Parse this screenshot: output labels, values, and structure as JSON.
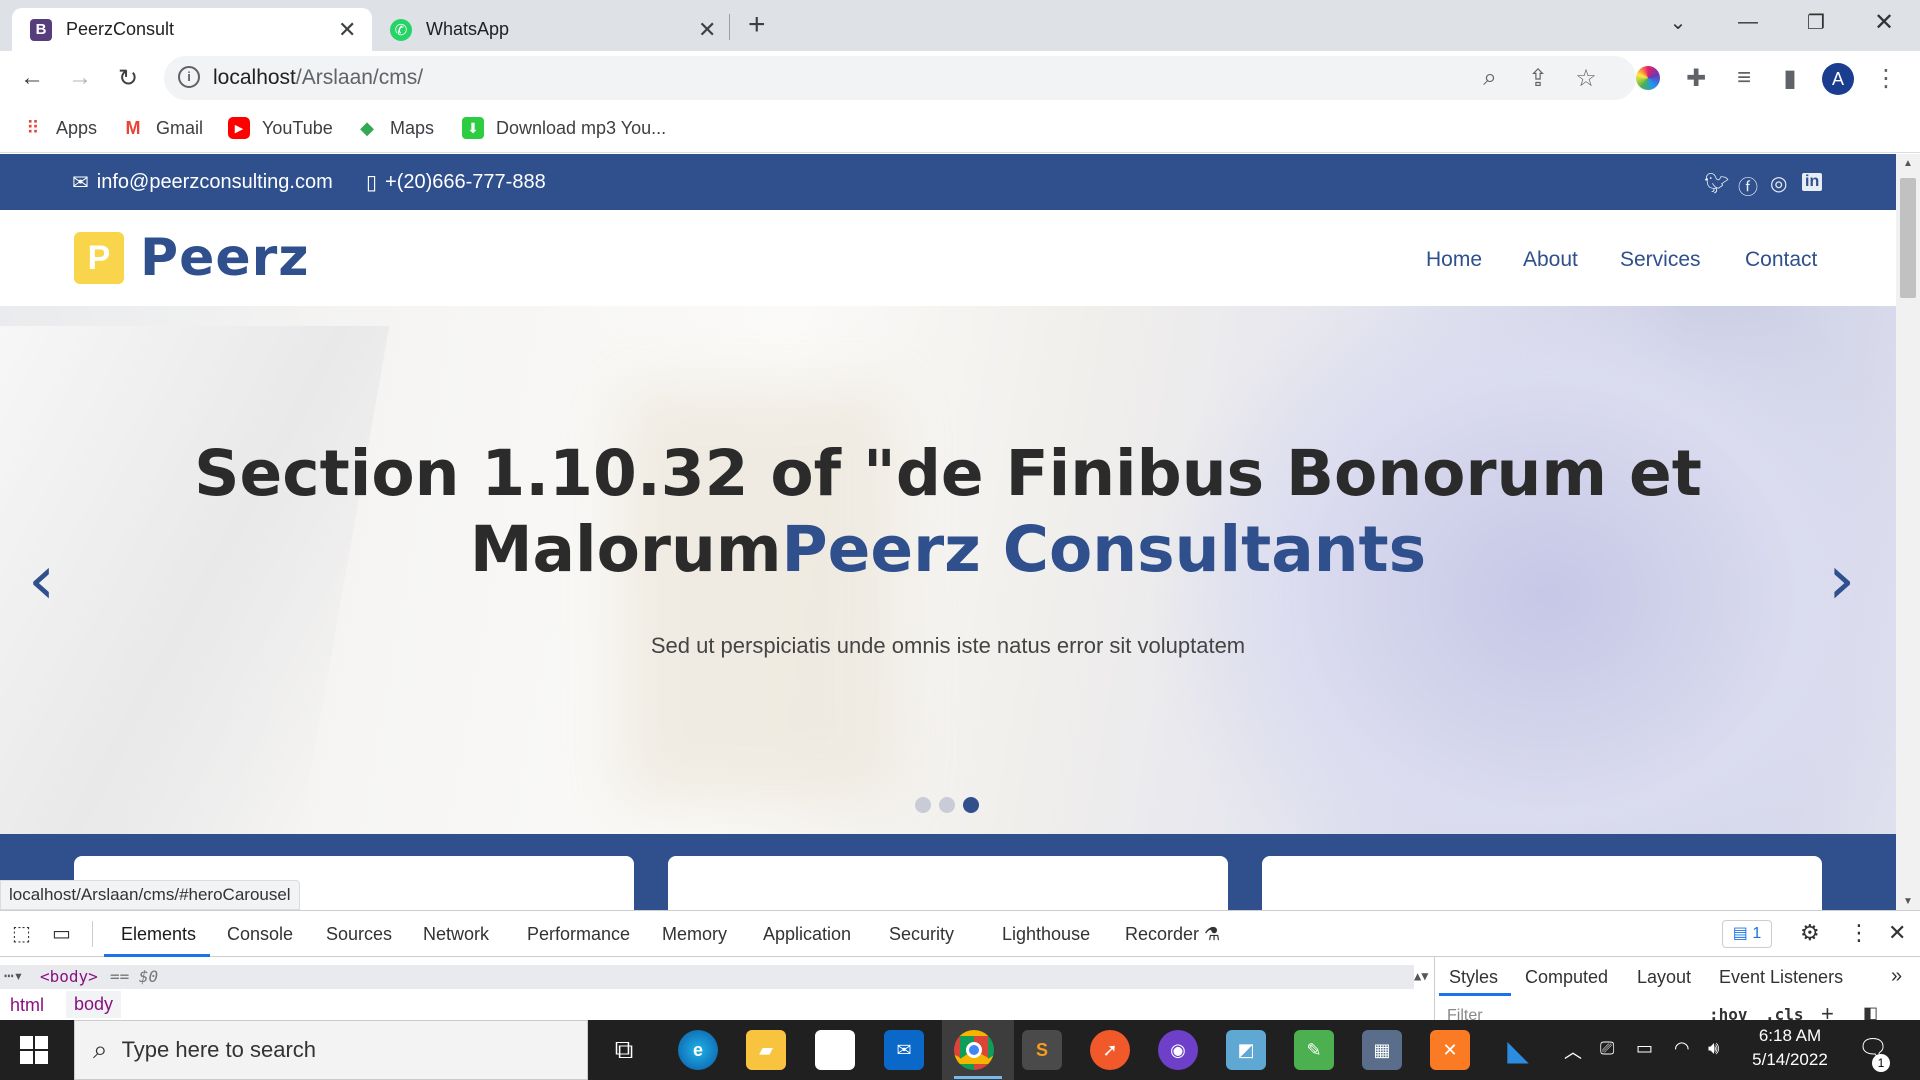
{
  "browser": {
    "tabs": [
      {
        "title": "PeerzConsult",
        "favicon_letter": "B",
        "favicon_color": "#563d7c"
      },
      {
        "title": "WhatsApp",
        "favicon_color": "#25d366"
      }
    ],
    "url_host": "localhost",
    "url_path": "/Arslaan/cms/",
    "bookmarks": [
      {
        "label": "Apps"
      },
      {
        "label": "Gmail"
      },
      {
        "label": "YouTube"
      },
      {
        "label": "Maps"
      },
      {
        "label": "Download mp3 You..."
      }
    ],
    "profile_letter": "A"
  },
  "site": {
    "email": "info@peerzconsulting.com",
    "phone": "+(20)666-777-888",
    "logo_letter": "P",
    "logo_text": "Peerz",
    "nav": [
      "Home",
      "About",
      "Services",
      "Contact"
    ],
    "brand_color": "#2f4f8d",
    "hero": {
      "title_main": "Section 1.10.32 of \"de Finibus Bonorum et Malorum",
      "title_accent": "Peerz Consultants",
      "subtitle": "Sed ut perspiciatis unde omnis iste natus error sit voluptatem",
      "active_slide": 3,
      "slide_count": 3
    }
  },
  "status_bar_url": "localhost/Arslaan/cms/#heroCarousel",
  "devtools": {
    "tabs": [
      "Elements",
      "Console",
      "Sources",
      "Network",
      "Performance",
      "Memory",
      "Application",
      "Security",
      "Lighthouse",
      "Recorder"
    ],
    "issues_count": "1",
    "element_line": "<body>",
    "element_eq": "== $0",
    "breadcrumb": [
      "html",
      "body"
    ],
    "styles_tabs": [
      "Styles",
      "Computed",
      "Layout",
      "Event Listeners"
    ],
    "filter_placeholder": "Filter",
    "hov": ":hov",
    "cls": ".cls"
  },
  "taskbar": {
    "search_placeholder": "Type here to search",
    "time": "6:18 AM",
    "date": "5/14/2022",
    "notification_count": "1"
  }
}
